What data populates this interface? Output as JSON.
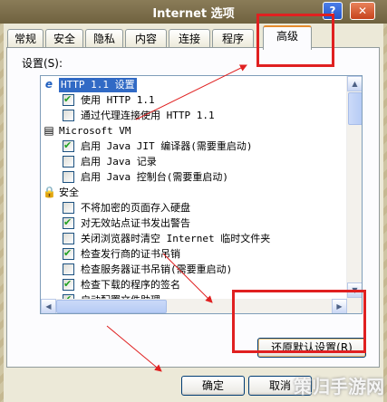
{
  "window": {
    "title": "Internet 选项",
    "help_glyph": "?",
    "close_glyph": "✕"
  },
  "tabs": [
    {
      "label": "常规"
    },
    {
      "label": "安全"
    },
    {
      "label": "隐私"
    },
    {
      "label": "内容"
    },
    {
      "label": "连接"
    },
    {
      "label": "程序"
    },
    {
      "label": "高级",
      "active": true
    }
  ],
  "settings": {
    "label": "设置(S):",
    "items": [
      {
        "type": "group",
        "icon": "ie-icon",
        "glyph": "e",
        "text": "HTTP 1.1 设置",
        "selected": true
      },
      {
        "type": "checkbox",
        "checked": true,
        "text": "使用 HTTP 1.1"
      },
      {
        "type": "checkbox",
        "checked": false,
        "text": "通过代理连接使用 HTTP 1.1"
      },
      {
        "type": "group",
        "icon": "document-icon",
        "glyph": "▤",
        "text": "Microsoft VM"
      },
      {
        "type": "checkbox",
        "checked": true,
        "text": "启用 Java JIT 编译器(需要重启动)"
      },
      {
        "type": "checkbox",
        "checked": false,
        "text": "启用 Java 记录"
      },
      {
        "type": "checkbox",
        "checked": false,
        "text": "启用 Java 控制台(需要重启动)"
      },
      {
        "type": "group",
        "icon": "lock-icon",
        "glyph": "🔒",
        "text": "安全"
      },
      {
        "type": "checkbox",
        "checked": false,
        "text": "不将加密的页面存入硬盘"
      },
      {
        "type": "checkbox",
        "checked": true,
        "text": "对无效站点证书发出警告"
      },
      {
        "type": "checkbox",
        "checked": false,
        "text": "关闭浏览器时清空 Internet 临时文件夹"
      },
      {
        "type": "checkbox",
        "checked": true,
        "text": "检查发行商的证书吊销"
      },
      {
        "type": "checkbox",
        "checked": false,
        "text": "检查服务器证书吊销(需要重启动)"
      },
      {
        "type": "checkbox",
        "checked": true,
        "text": "检查下载的程序的签名"
      },
      {
        "type": "checkbox",
        "checked": true,
        "text": "启动配置文件助理"
      }
    ]
  },
  "buttons": {
    "restore": "还原默认设置(R)",
    "ok": "确定",
    "cancel": "取消"
  },
  "annotation_color": "#e02020",
  "watermark": "策归手游网"
}
